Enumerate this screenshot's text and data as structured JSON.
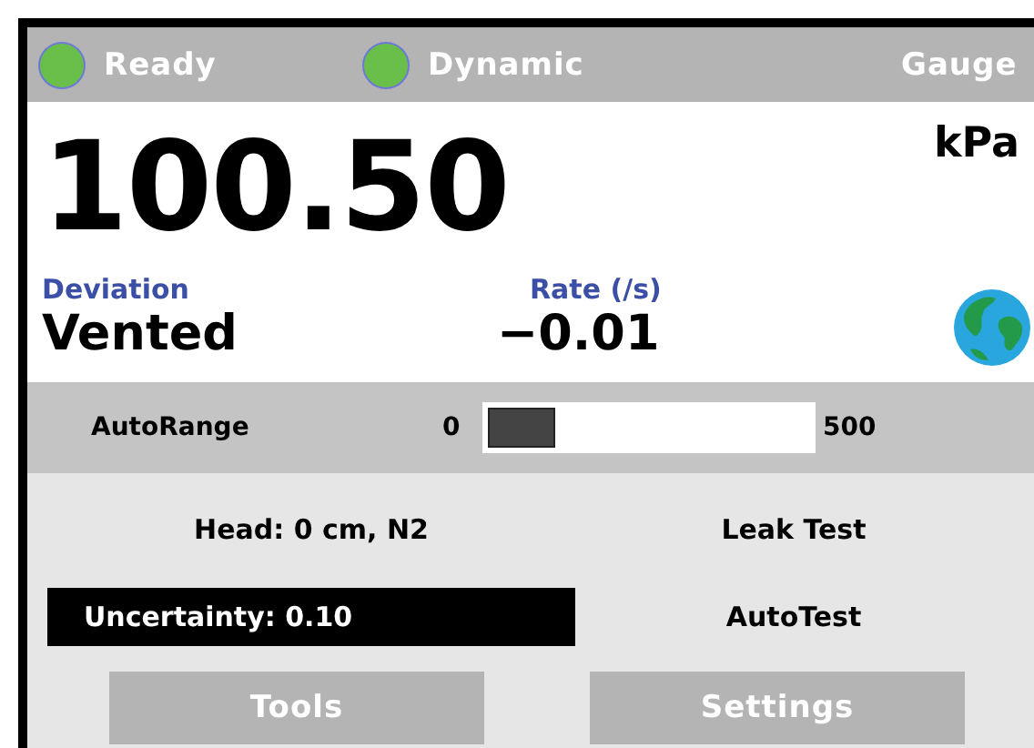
{
  "status_bar": [
    {
      "kind": "indicator",
      "label": "Ready",
      "color": "#6abf4b"
    },
    {
      "kind": "indicator",
      "label": "Dynamic",
      "color": "#6abf4b"
    },
    {
      "kind": "text",
      "label": "Gauge"
    }
  ],
  "reading": {
    "value": "100.50",
    "unit": "kPa"
  },
  "deviation": {
    "label": "Deviation",
    "value": "Vented"
  },
  "rate": {
    "label": "Rate (/s)",
    "value": "−0.01"
  },
  "range": {
    "label": "AutoRange",
    "min": "0",
    "max": "500",
    "level": 0.2
  },
  "menu": [
    {
      "label": "Head: 0 cm, N2",
      "selected": false
    },
    {
      "label": "Leak Test",
      "selected": false
    },
    {
      "label": "Uncertainty: 0.10",
      "selected": true
    },
    {
      "label": "AutoTest",
      "selected": false
    }
  ],
  "buttons": [
    "Tools",
    "Settings"
  ]
}
